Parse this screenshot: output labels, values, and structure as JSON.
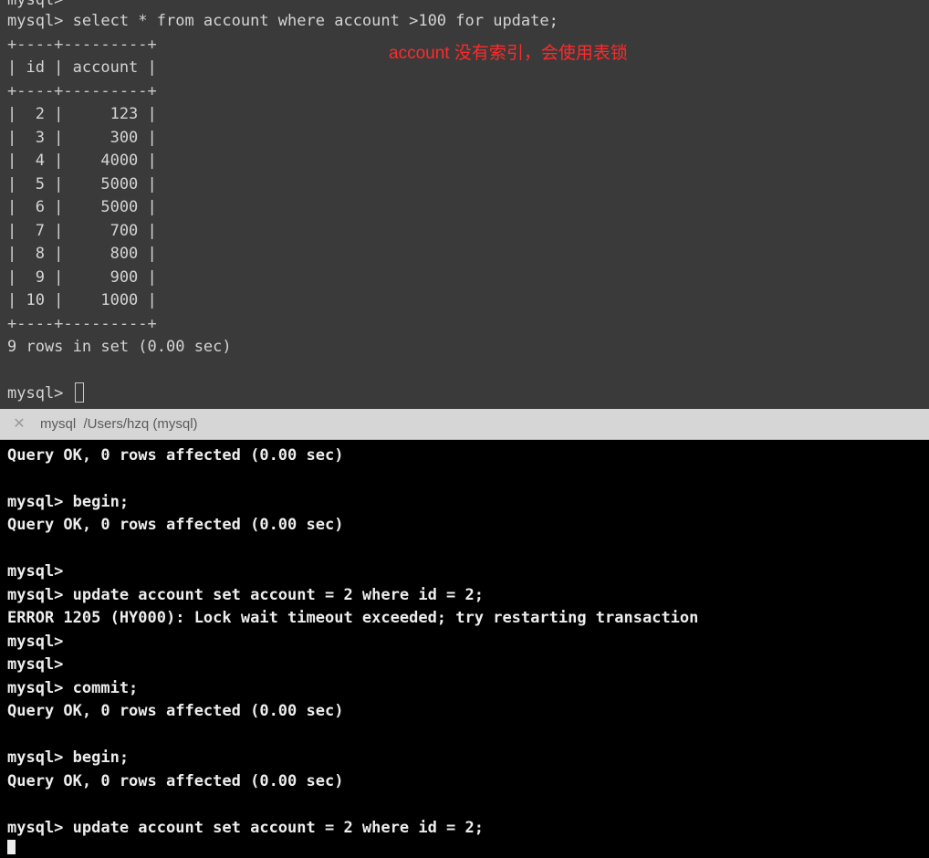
{
  "top_terminal": {
    "lines": [
      "mysql>",
      "mysql> select * from account where account >100 for update;",
      "+----+---------+",
      "| id | account |",
      "+----+---------+",
      "|  2 |     123 |",
      "|  3 |     300 |",
      "|  4 |    4000 |",
      "|  5 |    5000 |",
      "|  6 |    5000 |",
      "|  7 |     700 |",
      "|  8 |     800 |",
      "|  9 |     900 |",
      "| 10 |    1000 |",
      "+----+---------+",
      "9 rows in set (0.00 sec)",
      "",
      "mysql> "
    ],
    "annotation": "account 没有索引，会使用表锁"
  },
  "tab": {
    "close_icon": "close-icon",
    "title": "mysql  /Users/hzq (mysql)",
    "close_glyph": "✕"
  },
  "bottom_terminal": {
    "lines": [
      "Query OK, 0 rows affected (0.00 sec)",
      "",
      "mysql> begin;",
      "Query OK, 0 rows affected (0.00 sec)",
      "",
      "mysql>",
      "mysql> update account set account = 2 where id = 2;",
      "ERROR 1205 (HY000): Lock wait timeout exceeded; try restarting transaction",
      "mysql>",
      "mysql>",
      "mysql> commit;",
      "Query OK, 0 rows affected (0.00 sec)",
      "",
      "mysql> begin;",
      "Query OK, 0 rows affected (0.00 sec)",
      "",
      "mysql> update account set account = 2 where id = 2;"
    ]
  },
  "colors": {
    "top_background": "#3a3a3a",
    "bottom_background": "#000000",
    "annotation": "#ff2a2a",
    "tab_background": "#d6d6d6"
  }
}
